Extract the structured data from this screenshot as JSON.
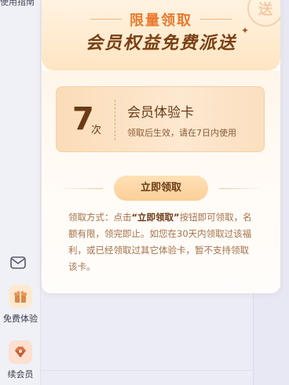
{
  "sidebar": {
    "top_link": "使用指南",
    "mail_icon": "mail-icon",
    "items": [
      {
        "label": "免费体验",
        "icon": "gift-icon"
      },
      {
        "label": "续会员",
        "icon": "diamond-icon"
      }
    ]
  },
  "card": {
    "subtitle": "限量领取",
    "title": "会员权益免费派送",
    "stamp_text": "送",
    "voucher": {
      "count": "7",
      "unit": "次",
      "name": "会员体验卡",
      "desc": "领取后生效，请在7日内使用"
    },
    "button_label": "立即领取",
    "rules": {
      "prefix": "领取方式：点击",
      "highlight": "“立即领取”",
      "suffix": "按钮即可领取，名额有限，领完即止。如您在30天内领取过该福利，或已经领取过其它体验卡，暂不支持领取该卡。"
    }
  },
  "colors": {
    "accent_orange": "#e9792d",
    "brown_text": "#6a3a16"
  }
}
